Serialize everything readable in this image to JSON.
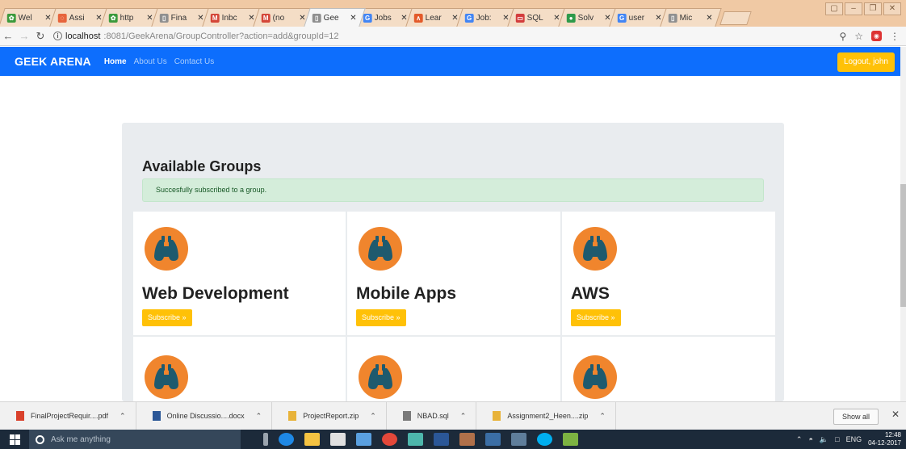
{
  "browser": {
    "tabs": [
      {
        "title": "Wel",
        "favicon_color": "#3c9a3c",
        "favicon_glyph": "✿"
      },
      {
        "title": "Assi",
        "favicon_color": "#e7643c",
        "favicon_glyph": "◌"
      },
      {
        "title": "http",
        "favicon_color": "#3c9a3c",
        "favicon_glyph": "✿"
      },
      {
        "title": "Fina",
        "favicon_color": "#8f8f8f",
        "favicon_glyph": "▯"
      },
      {
        "title": "Inbc",
        "favicon_color": "#d44638",
        "favicon_glyph": "M"
      },
      {
        "title": "(no",
        "favicon_color": "#d44638",
        "favicon_glyph": "M"
      },
      {
        "title": "Gee",
        "favicon_color": "#8f8f8f",
        "favicon_glyph": "▯"
      },
      {
        "title": "Jobs",
        "favicon_color": "#4285f4",
        "favicon_glyph": "G"
      },
      {
        "title": "Lear",
        "favicon_color": "#e35a2a",
        "favicon_glyph": "∧"
      },
      {
        "title": "Job:",
        "favicon_color": "#4285f4",
        "favicon_glyph": "G"
      },
      {
        "title": "SQL",
        "favicon_color": "#d33d3d",
        "favicon_glyph": "▭"
      },
      {
        "title": "Solv",
        "favicon_color": "#2e9a4a",
        "favicon_glyph": "●"
      },
      {
        "title": "user",
        "favicon_color": "#4285f4",
        "favicon_glyph": "G"
      },
      {
        "title": "Mic",
        "favicon_color": "#8f8f8f",
        "favicon_glyph": "▯"
      }
    ],
    "active_tab_index": 6,
    "url_host": "localhost",
    "url_path": ":8081/GeekArena/GroupController?action=add&groupId=12"
  },
  "navbar": {
    "brand": "GEEK ARENA",
    "links": [
      "Home",
      "About Us",
      "Contact Us"
    ],
    "logout_label": "Logout, john"
  },
  "main": {
    "title": "Available Groups",
    "alert": "Succesfully subscribed to a group.",
    "subscribe_label": "Subscribe »",
    "groups": [
      {
        "name": "Web Development"
      },
      {
        "name": "Mobile Apps"
      },
      {
        "name": "AWS"
      }
    ],
    "icon": "binoculars-icon",
    "icon_bg": "#f0852d",
    "icon_fg": "#1e5a6e"
  },
  "downloads": {
    "items": [
      {
        "name": "FinalProjectRequir....pdf",
        "icon_color": "#d9412b"
      },
      {
        "name": "Online Discussio....docx",
        "icon_color": "#2b5797"
      },
      {
        "name": "ProjectReport.zip",
        "icon_color": "#e8b33a"
      },
      {
        "name": "NBAD.sql",
        "icon_color": "#7a7a7a"
      },
      {
        "name": "Assignment2_Heen....zip",
        "icon_color": "#e8b33a"
      }
    ],
    "show_all": "Show all"
  },
  "taskbar": {
    "search_placeholder": "Ask me anything",
    "language": "ENG",
    "time": "12:48",
    "date": "04-12-2017"
  },
  "colors": {
    "navbar": "#0d6efd",
    "accent": "#ffc107",
    "alert_bg": "#d4edda"
  }
}
